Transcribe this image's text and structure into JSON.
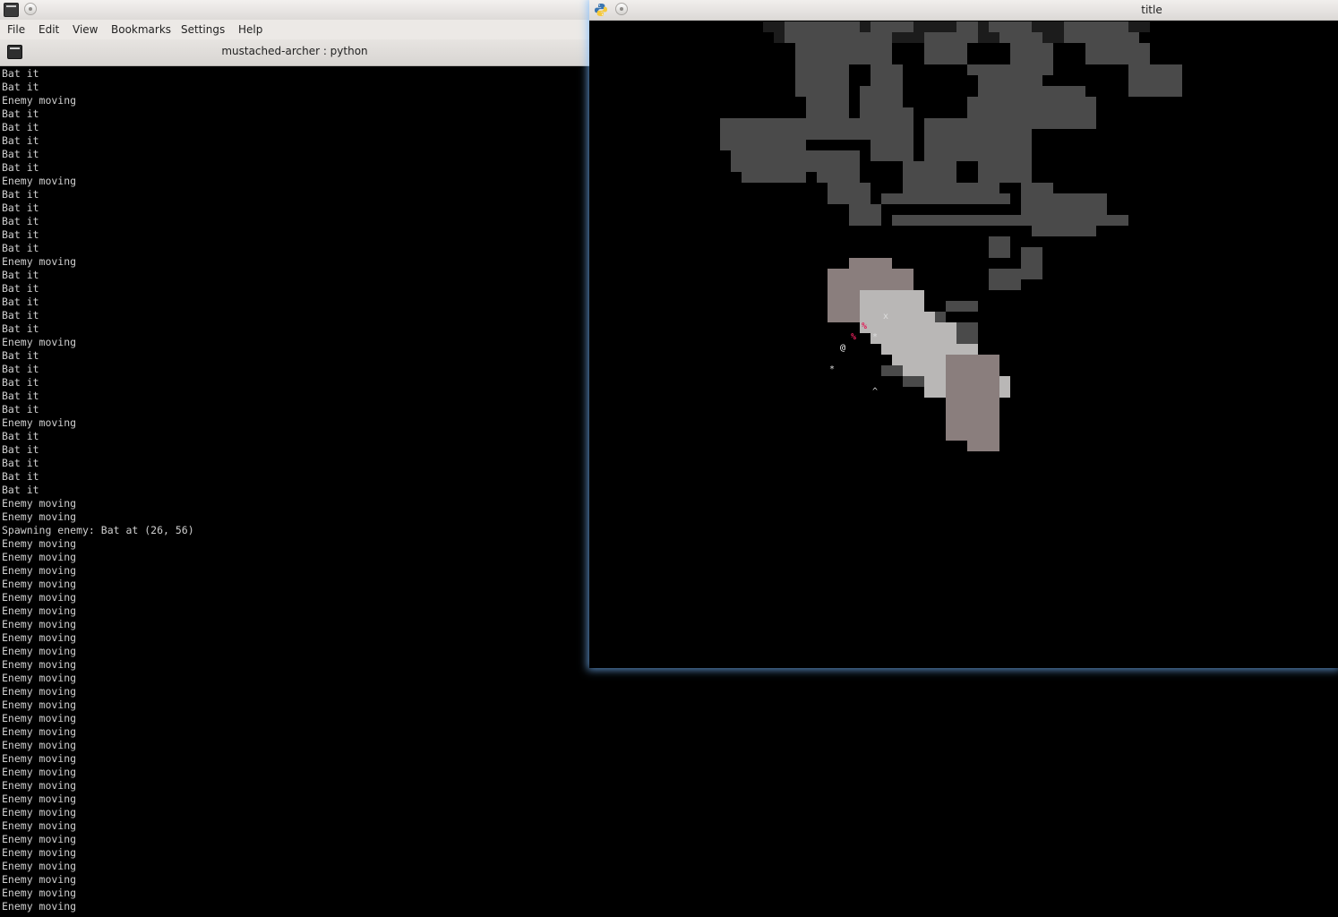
{
  "terminal": {
    "menu": [
      "File",
      "Edit",
      "View",
      "Bookmarks",
      "Settings",
      "Help"
    ],
    "tab_title": "mustached-archer : python",
    "lines": [
      "Bat it",
      "Bat it",
      "Enemy moving",
      "Bat it",
      "Bat it",
      "Bat it",
      "Bat it",
      "Bat it",
      "Enemy moving",
      "Bat it",
      "Bat it",
      "Bat it",
      "Bat it",
      "Bat it",
      "Enemy moving",
      "Bat it",
      "Bat it",
      "Bat it",
      "Bat it",
      "Bat it",
      "Enemy moving",
      "Bat it",
      "Bat it",
      "Bat it",
      "Bat it",
      "Bat it",
      "Enemy moving",
      "Bat it",
      "Bat it",
      "Bat it",
      "Bat it",
      "Bat it",
      "Enemy moving",
      "Enemy moving",
      "Spawning enemy: Bat at (26, 56)",
      "Enemy moving",
      "Enemy moving",
      "Enemy moving",
      "Enemy moving",
      "Enemy moving",
      "Enemy moving",
      "Enemy moving",
      "Enemy moving",
      "Enemy moving",
      "Enemy moving",
      "Enemy moving",
      "Enemy moving",
      "Enemy moving",
      "Enemy moving",
      "Enemy moving",
      "Enemy moving",
      "Enemy moving",
      "Enemy moving",
      "Enemy moving",
      "Enemy moving",
      "Enemy moving",
      "Enemy moving",
      "Enemy moving",
      "Enemy moving",
      "Enemy moving",
      "Enemy moving",
      "Enemy moving",
      "Enemy moving"
    ]
  },
  "game": {
    "title": "title",
    "glyphs": {
      "player": "@",
      "corpse": "%",
      "item": "*",
      "exit": "x",
      "stairs": "^"
    },
    "colors": {
      "corpse": "#e0205a",
      "player": "#ffffff",
      "wall_dark": "#1c1c1c",
      "floor_dark": "#4a4a4a",
      "floor_lit": "#b9b7b6",
      "floor_dim": "#8a7e7d"
    },
    "icons": {
      "app_icon": "python-icon",
      "terminal_icon": "terminal-icon"
    }
  }
}
